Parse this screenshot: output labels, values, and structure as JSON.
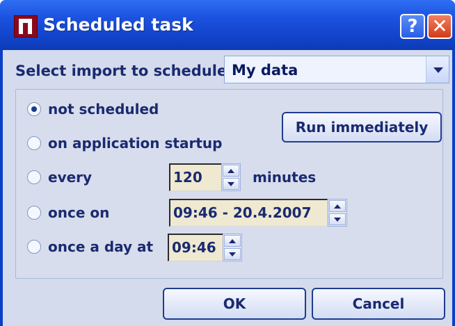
{
  "window": {
    "title": "Scheduled task",
    "help_label": "?",
    "close_label": "✕"
  },
  "select_import": {
    "label": "Select import to schedule",
    "value": "My data"
  },
  "schedule": {
    "options": [
      {
        "label": "not scheduled",
        "checked": true
      },
      {
        "label": "on application startup",
        "checked": false
      },
      {
        "label": "every",
        "checked": false
      },
      {
        "label": "once on",
        "checked": false
      },
      {
        "label": "once a day at",
        "checked": false
      }
    ],
    "run_button": "Run immediately",
    "every_value": "120",
    "every_unit": "minutes",
    "once_on_value": "09:46 - 20.4.2007",
    "daily_value": "09:46"
  },
  "buttons": {
    "ok": "OK",
    "cancel": "Cancel"
  },
  "icons": {
    "app": "app-logo-icon",
    "help": "help-icon",
    "close": "close-icon",
    "dropdown": "chevron-down-icon",
    "spin_up": "spin-up-icon",
    "spin_down": "spin-down-icon"
  }
}
